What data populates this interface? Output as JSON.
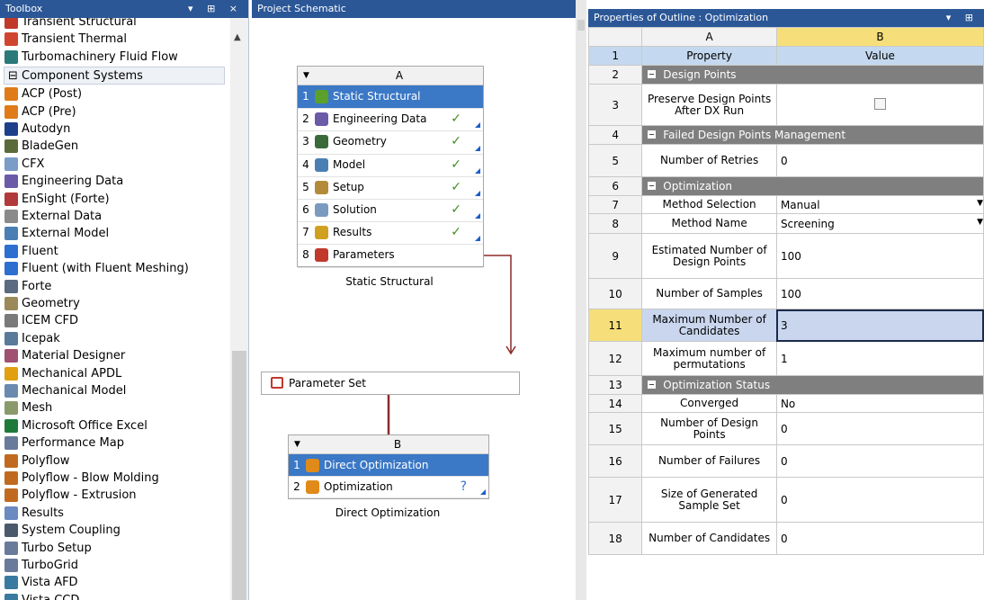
{
  "toolbox": {
    "title": "Toolbox",
    "controls": "▾ ⊞ ×",
    "items_top": [
      {
        "label": "Transient Structural",
        "icon": "transient-structural-icon",
        "color": "#c0392b"
      },
      {
        "label": "Transient Thermal",
        "icon": "transient-thermal-icon",
        "color": "#d0452f"
      },
      {
        "label": "Turbomachinery Fluid Flow",
        "icon": "turbomachinery-icon",
        "color": "#2a7a7a"
      }
    ],
    "group_label": "⊟ Component Systems",
    "items": [
      {
        "label": "ACP (Post)",
        "icon": "acp-post-icon",
        "color": "#e07b1a"
      },
      {
        "label": "ACP (Pre)",
        "icon": "acp-pre-icon",
        "color": "#e07b1a"
      },
      {
        "label": "Autodyn",
        "icon": "autodyn-icon",
        "color": "#1e3f8a"
      },
      {
        "label": "BladeGen",
        "icon": "bladegen-icon",
        "color": "#5a6a3a"
      },
      {
        "label": "CFX",
        "icon": "cfx-icon",
        "color": "#7a9cc6"
      },
      {
        "label": "Engineering Data",
        "icon": "engineering-data-icon",
        "color": "#6a5aa8"
      },
      {
        "label": "EnSight (Forte)",
        "icon": "ensight-icon",
        "color": "#b33a3a"
      },
      {
        "label": "External Data",
        "icon": "external-data-icon",
        "color": "#8a8a8a"
      },
      {
        "label": "External Model",
        "icon": "external-model-icon",
        "color": "#4a7fb3"
      },
      {
        "label": "Fluent",
        "icon": "fluent-icon",
        "color": "#2d6fd0"
      },
      {
        "label": "Fluent (with Fluent Meshing)",
        "icon": "fluent-meshing-icon",
        "color": "#2d6fd0"
      },
      {
        "label": "Forte",
        "icon": "forte-icon",
        "color": "#5a6a80"
      },
      {
        "label": "Geometry",
        "icon": "geometry-icon",
        "color": "#9a8a5a"
      },
      {
        "label": "ICEM CFD",
        "icon": "icem-cfd-icon",
        "color": "#7a7a7a"
      },
      {
        "label": "Icepak",
        "icon": "icepak-icon",
        "color": "#5a7a9a"
      },
      {
        "label": "Material Designer",
        "icon": "material-designer-icon",
        "color": "#a05070"
      },
      {
        "label": "Mechanical APDL",
        "icon": "mechanical-apdl-icon",
        "color": "#e0a010"
      },
      {
        "label": "Mechanical Model",
        "icon": "mechanical-model-icon",
        "color": "#6a8ab0"
      },
      {
        "label": "Mesh",
        "icon": "mesh-icon",
        "color": "#8a9a6a"
      },
      {
        "label": "Microsoft Office Excel",
        "icon": "excel-icon",
        "color": "#1f7a3a"
      },
      {
        "label": "Performance Map",
        "icon": "performance-map-icon",
        "color": "#6a7a9a"
      },
      {
        "label": "Polyflow",
        "icon": "polyflow-icon",
        "color": "#c06a20"
      },
      {
        "label": "Polyflow - Blow Molding",
        "icon": "polyflow-blow-molding-icon",
        "color": "#c06a20"
      },
      {
        "label": "Polyflow - Extrusion",
        "icon": "polyflow-extrusion-icon",
        "color": "#c06a20"
      },
      {
        "label": "Results",
        "icon": "results-icon",
        "color": "#6a8ac0"
      },
      {
        "label": "System Coupling",
        "icon": "system-coupling-icon",
        "color": "#4a5a6a"
      },
      {
        "label": "Turbo Setup",
        "icon": "turbo-setup-icon",
        "color": "#6a7a9a"
      },
      {
        "label": "TurboGrid",
        "icon": "turbogrid-icon",
        "color": "#6a7a9a"
      },
      {
        "label": "Vista AFD",
        "icon": "vista-afd-icon",
        "color": "#3a7aa0"
      },
      {
        "label": "Vista CCD",
        "icon": "vista-ccd-icon",
        "color": "#3a7aa0"
      }
    ]
  },
  "schematic": {
    "title": "Project Schematic",
    "system_a": {
      "col": "A",
      "name": "Static Structural",
      "cells": [
        {
          "num": "1",
          "label": "Static Structural",
          "icon": "static-structural-icon",
          "color": "#5aa02a",
          "check": "",
          "selected": true
        },
        {
          "num": "2",
          "label": "Engineering Data",
          "icon": "engineering-data-icon",
          "color": "#6a5aa8",
          "check": "✓"
        },
        {
          "num": "3",
          "label": "Geometry",
          "icon": "geometry-icon",
          "color": "#3a6a3a",
          "check": "✓"
        },
        {
          "num": "4",
          "label": "Model",
          "icon": "model-icon",
          "color": "#4a7fb3",
          "check": "✓"
        },
        {
          "num": "5",
          "label": "Setup",
          "icon": "setup-icon",
          "color": "#b38a3a",
          "check": "✓"
        },
        {
          "num": "6",
          "label": "Solution",
          "icon": "solution-icon",
          "color": "#7a9ac0",
          "check": "✓"
        },
        {
          "num": "7",
          "label": "Results",
          "icon": "results-icon",
          "color": "#d0a020",
          "check": "✓"
        },
        {
          "num": "8",
          "label": "Parameters",
          "icon": "parameters-icon",
          "color": "#c0392b",
          "check": ""
        }
      ]
    },
    "parameter_set": "Parameter Set",
    "system_b": {
      "col": "B",
      "name": "Direct Optimization",
      "cells": [
        {
          "num": "1",
          "label": "Direct Optimization",
          "icon": "direct-optimization-icon",
          "color": "#e08a1a",
          "check": "",
          "selected": true
        },
        {
          "num": "2",
          "label": "Optimization",
          "icon": "optimization-icon",
          "color": "#e08a1a",
          "check": "?"
        }
      ]
    },
    "link_color": "#8b2a2a"
  },
  "properties": {
    "title": "Properties of Outline : Optimization",
    "controls": "▾ ⊞",
    "col_a": "A",
    "col_b": "B",
    "header": {
      "num": "1",
      "property": "Property",
      "value": "Value"
    },
    "rows": [
      {
        "num": "2",
        "type": "group",
        "label": "Design Points"
      },
      {
        "num": "3",
        "type": "row",
        "property": "Preserve Design Points After DX Run",
        "value": "",
        "control": "checkbox",
        "height": 46
      },
      {
        "num": "4",
        "type": "group",
        "label": "Failed Design Points Management"
      },
      {
        "num": "5",
        "type": "row",
        "property": "Number of Retries",
        "value": "0",
        "height": 36
      },
      {
        "num": "6",
        "type": "group",
        "label": "Optimization"
      },
      {
        "num": "7",
        "type": "row",
        "property": "Method Selection",
        "value": "Manual",
        "control": "dropdown",
        "height": 20
      },
      {
        "num": "8",
        "type": "row",
        "property": "Method Name",
        "value": "Screening",
        "control": "dropdown",
        "height": 22
      },
      {
        "num": "9",
        "type": "row",
        "property": "Estimated Number of Design Points",
        "value": "100",
        "height": 50
      },
      {
        "num": "10",
        "type": "row",
        "property": "Number of Samples",
        "value": "100",
        "height": 34
      },
      {
        "num": "11",
        "type": "row",
        "property": "Maximum Number of Candidates",
        "value": "3",
        "height": 36,
        "highlight": true
      },
      {
        "num": "12",
        "type": "row",
        "property": "Maximum number of permutations",
        "value": "1",
        "height": 38
      },
      {
        "num": "13",
        "type": "group",
        "label": "Optimization Status"
      },
      {
        "num": "14",
        "type": "row",
        "property": "Converged",
        "value": "No",
        "height": 20
      },
      {
        "num": "15",
        "type": "row",
        "property": "Number of Design Points",
        "value": "0",
        "height": 36
      },
      {
        "num": "16",
        "type": "row",
        "property": "Number of Failures",
        "value": "0",
        "height": 36
      },
      {
        "num": "17",
        "type": "row",
        "property": "Size of Generated Sample Set",
        "value": "0",
        "height": 50
      },
      {
        "num": "18",
        "type": "row",
        "property": "Number of Candidates",
        "value": "0",
        "height": 36
      }
    ]
  }
}
